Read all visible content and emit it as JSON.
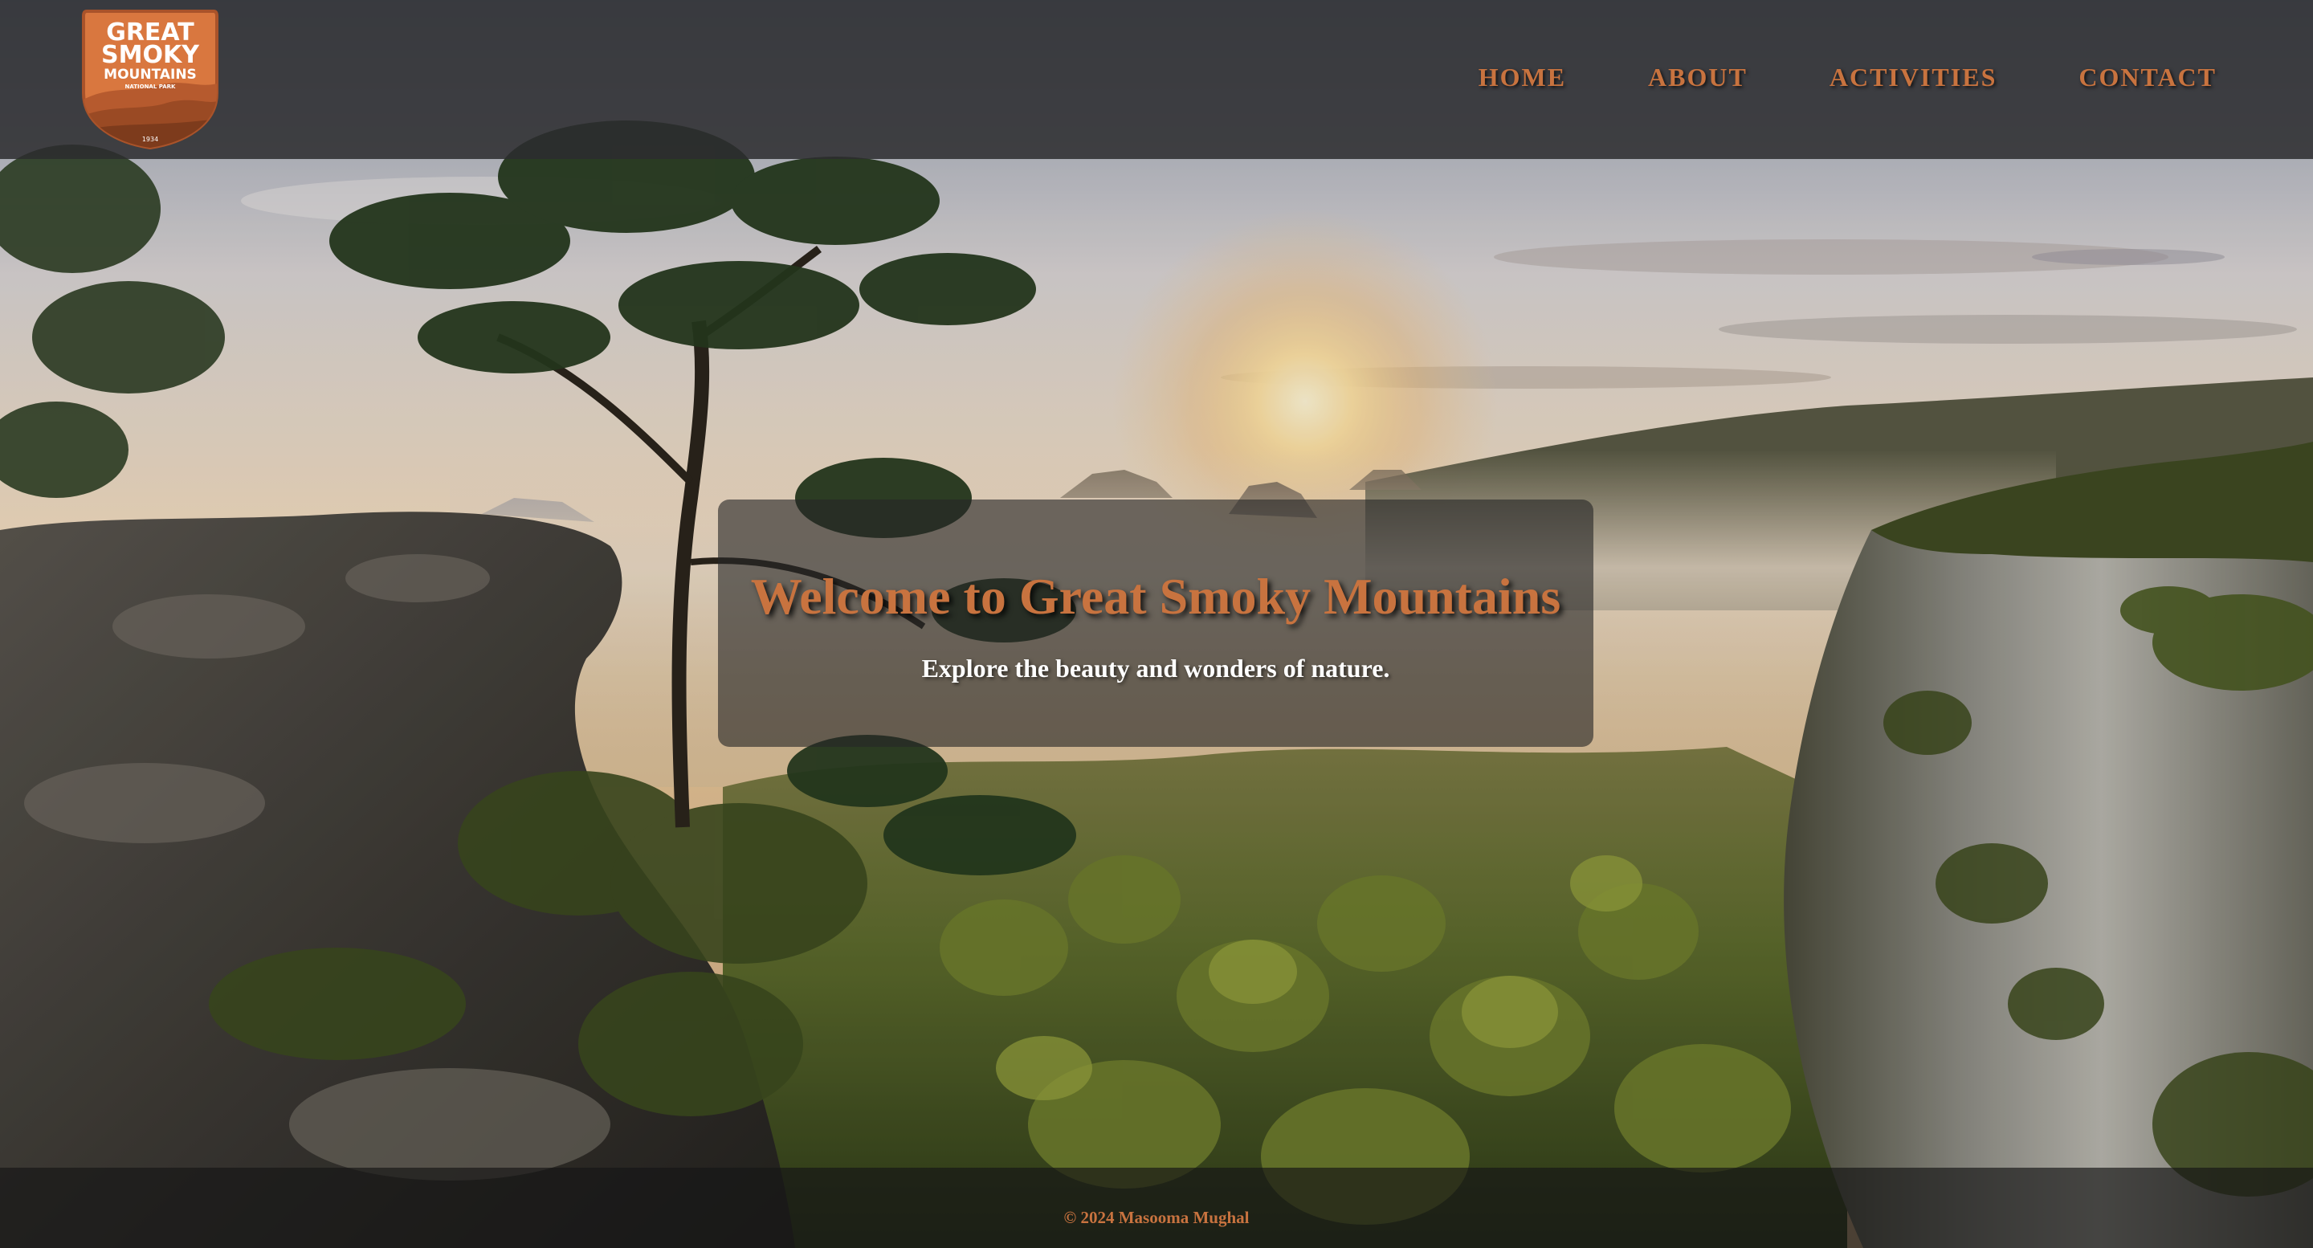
{
  "site": {
    "logo": {
      "line1": "GREAT",
      "line2": "SMOKY",
      "line3": "MOUNTAINS",
      "subtitle": "NATIONAL PARK",
      "year": "1934",
      "colors": {
        "badge": "#d9773f",
        "badge_dark": "#a9532a",
        "text": "#ffffff"
      }
    },
    "nav": {
      "items": [
        {
          "label": "HOME"
        },
        {
          "label": "ABOUT"
        },
        {
          "label": "ACTIVITIES"
        },
        {
          "label": "CONTACT"
        }
      ]
    },
    "hero": {
      "title": "Welcome to Great Smoky Mountains",
      "subtitle": "Explore the beauty and wonders of nature."
    },
    "footer": {
      "text": "© 2024 Masooma Mughal"
    },
    "colors": {
      "accent": "#c8733f",
      "header_bg": "#2c2c2e",
      "hero_box_bg": "#262626",
      "hero_subtitle": "#ffffff"
    },
    "background": {
      "description_icon": "mountain-landscape-photo"
    }
  }
}
